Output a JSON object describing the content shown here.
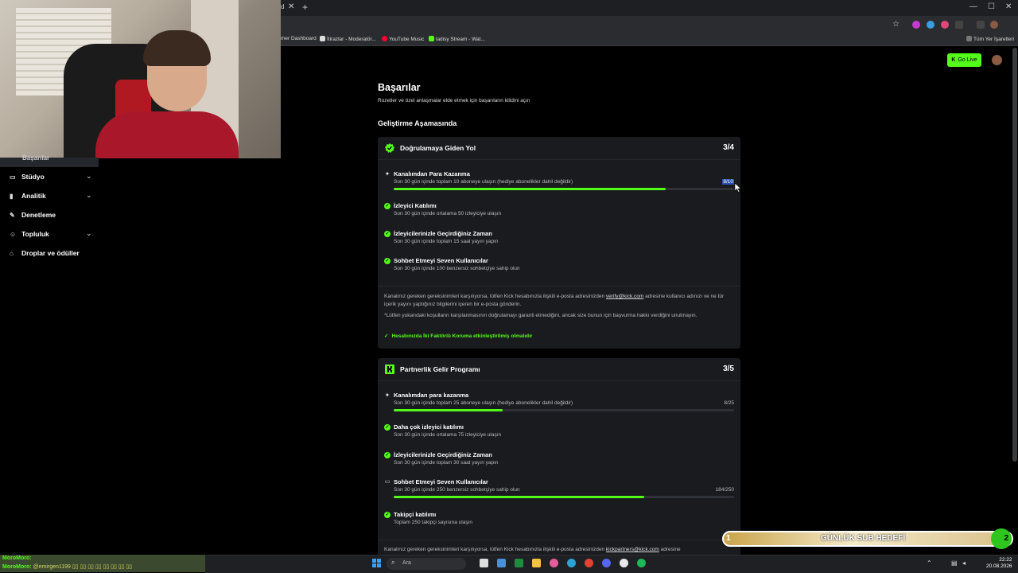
{
  "browser": {
    "tab_partial": "d",
    "tab_close": "✕",
    "new_tab": "+",
    "window_controls": [
      "—",
      "☐",
      "✕"
    ],
    "bookmarks": [
      {
        "label": "mer Dashboard",
        "color": "#333333"
      },
      {
        "label": "İtirazlar - Moderatör...",
        "color": "#dddddd"
      },
      {
        "label": "YouTube Music",
        "color": "#ff0033"
      },
      {
        "label": "ladisy Stream - Wat...",
        "color": "#53fc18"
      }
    ],
    "all_bookmarks": "Tüm Yer İşaretleri"
  },
  "sidebar": {
    "active": "Başarılar",
    "items": [
      {
        "label": "Stüdyo",
        "icon": "studio-icon",
        "glyph": "▭",
        "chevron": "⌄"
      },
      {
        "label": "Analitik",
        "icon": "analytics-icon",
        "glyph": "▮",
        "chevron": "⌄"
      },
      {
        "label": "Denetleme",
        "icon": "wrench-icon",
        "glyph": "✎",
        "chevron": ""
      },
      {
        "label": "Topluluk",
        "icon": "community-icon",
        "glyph": "☺",
        "chevron": "⌄"
      },
      {
        "label": "Droplar ve ödüller",
        "icon": "gift-icon",
        "glyph": "⌂",
        "chevron": ""
      }
    ]
  },
  "header": {
    "go_live": "Go Live",
    "go_live_icon": "K"
  },
  "main": {
    "title": "Başarılar",
    "subtitle": "Rozetler ve özel anlaşmalar elde etmek için başarıların kilidini açın",
    "section": "Geliştirme Aşamasında",
    "card1": {
      "title": "Doğrulamaya Giden Yol",
      "count": "3/4",
      "requirements": [
        {
          "title": "Kanalımdan Para Kazanma",
          "desc": "Son 30 gün içinde toplam 10 aboneye ulaşın (hediye abonelikler dahil değildir)",
          "value": "8/10",
          "progress": 0.8,
          "done": false
        },
        {
          "title": "İzleyici Katılımı",
          "desc": "Son 30 gün içinde ortalama 50 izleyiciye ulaşın",
          "done": true
        },
        {
          "title": "İzleyicilerinizle Geçirdiğiniz Zaman",
          "desc": "Son 30 gün içinde toplam 15 saat yayın yapın",
          "done": true
        },
        {
          "title": "Sohbet Etmeyi Seven Kullanıcılar",
          "desc": "Son 30 gün içinde 100 benzersiz sohbetçiye sahip olun",
          "done": true
        }
      ],
      "note1_pre": "Kanalınız gereken gereksinimleri karşılıyorsa, lütfen Kick hesabınızla ilişkili e-posta adresinizden",
      "note1_email": "verify@kick.com",
      "note1_post": "adresine kullanıcı adınızı ve ne tür içerik yayını yaptığınız bilgilerini içeren bir e-posta gönderin.",
      "note2": "*Lütfen yukarıdaki koşulların karşılanmasının doğrulamayı garanti etmediğini, ancak size bunun için başvurma hakkı verdiğini unutmayın.",
      "twofa": "Hesabınızda İki Faktörlü Koruma etkinleştirilmiş olmalıdır"
    },
    "card2": {
      "title": "Partnerlik Gelir Programı",
      "count": "3/5",
      "requirements": [
        {
          "title": "Kanalımdan para kazanma",
          "desc": "Son 30 gün içinde toplam 25 aboneye ulaşın (hediye abonelikler dahil değildir)",
          "value": "8/25",
          "progress": 0.32,
          "done": false,
          "icon": "spark"
        },
        {
          "title": "Daha çok izleyici katılımı",
          "desc": "Son 30 gün içinde ortalama 75 izleyiciye ulaşın",
          "done": true
        },
        {
          "title": "İzleyicilerinizle Geçirdiğiniz Zaman",
          "desc": "Son 30 gün içinde toplam 30 saat yayın yapın",
          "done": true
        },
        {
          "title": "Sohbet Etmeyi Seven Kullanıcılar",
          "desc": "Son 30 gün içinde 250 benzersiz sohbetçiye sahip olun",
          "value": "184/250",
          "progress": 0.736,
          "done": false,
          "icon": "chat"
        },
        {
          "title": "Takipçi katılımı",
          "desc": "Toplam 250 takipçi sayısına ulaşın",
          "done": true
        }
      ],
      "note_pre": "Kanalınız gereken gereksinimleri karşılıyorsa, lütfen Kick hesabınızla ilişkili e-posta adresinizden",
      "note_email": "kickpartners@kick.com",
      "note_post": "adresine"
    }
  },
  "overlay": {
    "subgoal_num": "1",
    "subgoal_title": "GÜNLÜK SUB HEDEFİ",
    "subgoal_target": "2",
    "chat": [
      {
        "user": "MoroMoro:",
        "msg": "",
        "color": "#53fc18"
      },
      {
        "user": "MoroMoro:",
        "msg": "@emirgen1199  ▯▯ ▯▯ ▯▯ ▯▯ ▯▯ ▯▯ ▯▯ ▯▯",
        "color": "#53fc18"
      }
    ]
  },
  "taskbar": {
    "search_placeholder": "Ara",
    "time": "22:22",
    "date": "20.08.2026"
  }
}
